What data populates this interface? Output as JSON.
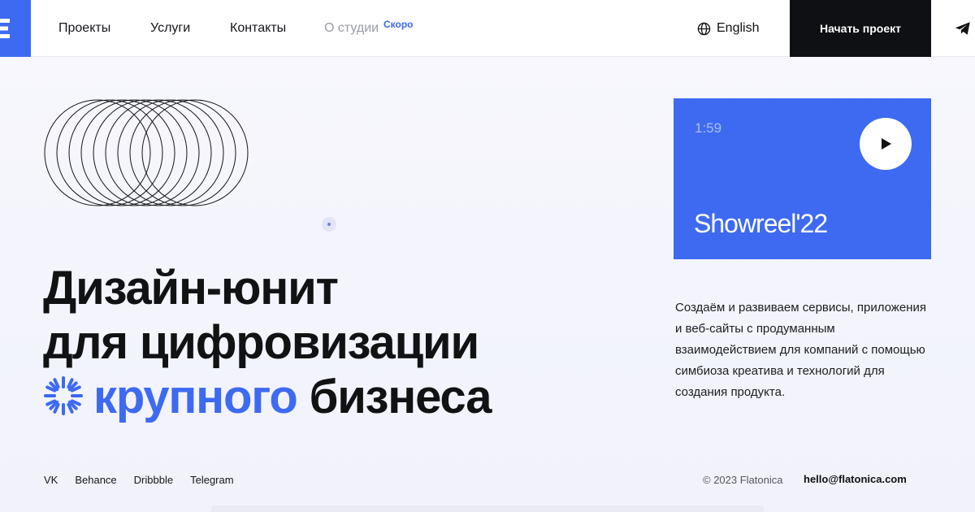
{
  "header": {
    "logo_icon": "flatonica-logo-icon",
    "nav": [
      {
        "label": "Проекты"
      },
      {
        "label": "Услуги"
      },
      {
        "label": "Контакты"
      },
      {
        "label": "О студии"
      }
    ],
    "soon_badge": "Скоро",
    "language": {
      "icon": "globe-icon",
      "label": "English"
    },
    "cta_label": "Начать проект",
    "telegram_icon": "telegram-icon"
  },
  "hero": {
    "decor_icon": "concentric-rings-icon",
    "headline_line1": "Дизайн-юнит",
    "headline_line2": "для цифровизации",
    "headline_accent": "крупного",
    "headline_end": "бизнеса",
    "burst_icon": "loader-burst-icon"
  },
  "showreel": {
    "duration": "1:59",
    "play_icon": "play-icon",
    "title": "Showreel'22"
  },
  "description": "Создаём и развиваем сервисы, приложения и веб-сайты с продуманным взаимодействием для компаний с помощью симбиоза креатива и технологий для создания продукта.",
  "footer": {
    "socials": [
      {
        "label": "VK"
      },
      {
        "label": "Behance"
      },
      {
        "label": "Dribbble"
      },
      {
        "label": "Telegram"
      }
    ],
    "copyright": "© 2023 Flatonica",
    "email": "hello@flatonica.com"
  },
  "colors": {
    "accent": "#3e6af2",
    "dark": "#0f1013",
    "background": "#f4f5fc"
  }
}
